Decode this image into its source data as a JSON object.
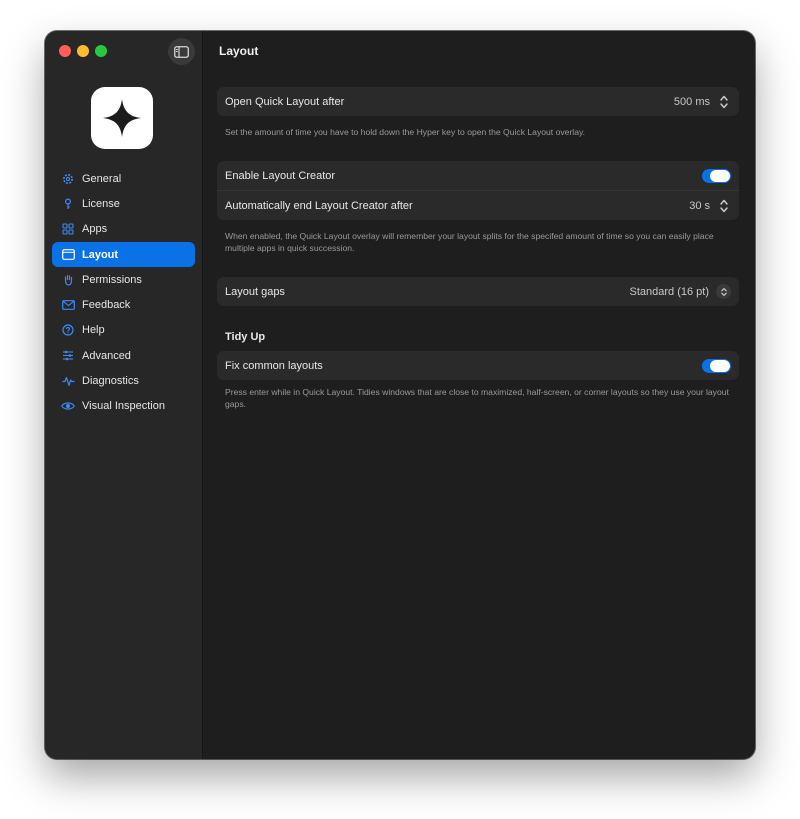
{
  "window": {
    "title": "Layout"
  },
  "sidebar": {
    "items": [
      {
        "label": "General",
        "icon": "gear-icon"
      },
      {
        "label": "License",
        "icon": "key-icon"
      },
      {
        "label": "Apps",
        "icon": "grid-icon"
      },
      {
        "label": "Layout",
        "icon": "window-layout-icon",
        "active": true
      },
      {
        "label": "Permissions",
        "icon": "hand-icon"
      },
      {
        "label": "Feedback",
        "icon": "envelope-icon"
      },
      {
        "label": "Help",
        "icon": "question-circle-icon"
      },
      {
        "label": "Advanced",
        "icon": "sliders-icon"
      },
      {
        "label": "Diagnostics",
        "icon": "waveform-icon"
      },
      {
        "label": "Visual Inspection",
        "icon": "eye-icon"
      }
    ]
  },
  "quick_layout": {
    "label": "Open Quick Layout after",
    "value": "500 ms",
    "help": "Set the amount of time you have to hold down the Hyper key to open the Quick Layout overlay."
  },
  "layout_creator": {
    "enable_label": "Enable Layout Creator",
    "enabled": true,
    "auto_end_label": "Automatically end Layout Creator after",
    "auto_end_value": "30 s",
    "help": "When enabled, the Quick Layout overlay will remember your layout splits for the specifed amount of time so you can easily place multiple apps in quick succession."
  },
  "layout_gaps": {
    "label": "Layout gaps",
    "value": "Standard (16 pt)"
  },
  "tidy_up": {
    "title": "Tidy Up",
    "fix_label": "Fix common layouts",
    "enabled": true,
    "help": "Press enter while in Quick Layout. Tidies windows that are close to maximized, half-screen, or corner layouts so they use your layout gaps."
  },
  "colors": {
    "accent": "#0a72e6",
    "sidebar_bg": "#272727",
    "content_bg": "#1e1e1e",
    "card_bg": "#2a2a2a"
  }
}
